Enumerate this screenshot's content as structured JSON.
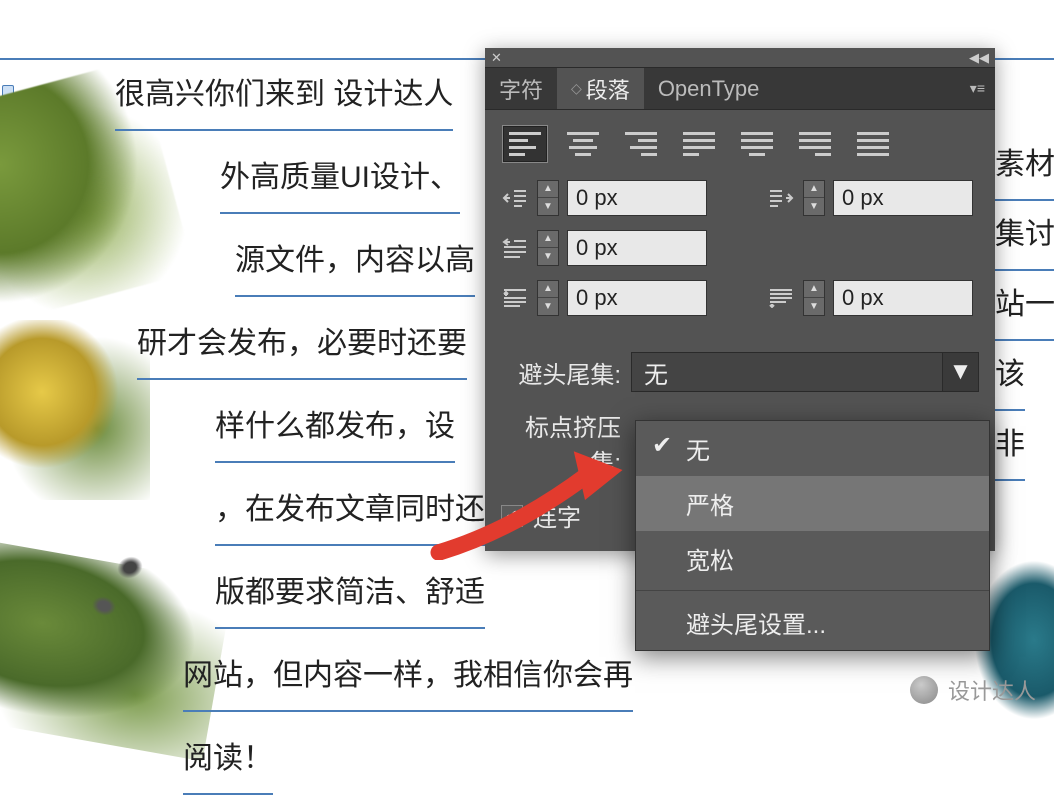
{
  "document": {
    "lines": {
      "l1": "很高兴你们来到 设计达人",
      "l2": "外高质量UI设计、",
      "l3": "源文件，内容以高",
      "l4": "研才会发布，必要时还要",
      "l5": "样什么都发布，设",
      "l6": "，在发布文章同时还",
      "l7": "版都要求简洁、舒适",
      "l8": "网站，但内容一样，我相信你会再",
      "l9": "阅读！",
      "r2": "素材",
      "r3": "集讨",
      "r4": "站一",
      "r5": "该",
      "r6": "非"
    }
  },
  "panel": {
    "tabs": {
      "char": "字符",
      "para": "段落",
      "opentype": "OpenType"
    },
    "fields": {
      "indent_left": "0 px",
      "indent_right": "0 px",
      "indent_first": "0 px",
      "space_before": "0 px",
      "space_after": "0 px"
    },
    "kinsoku_label": "避头尾集:",
    "kinsoku_value": "无",
    "mojikumi_label": "标点挤压集:",
    "hyphenate_label": "连字"
  },
  "dropdown": {
    "none": "无",
    "strict": "严格",
    "loose": "宽松",
    "settings": "避头尾设置..."
  },
  "watermark": "设计达人"
}
